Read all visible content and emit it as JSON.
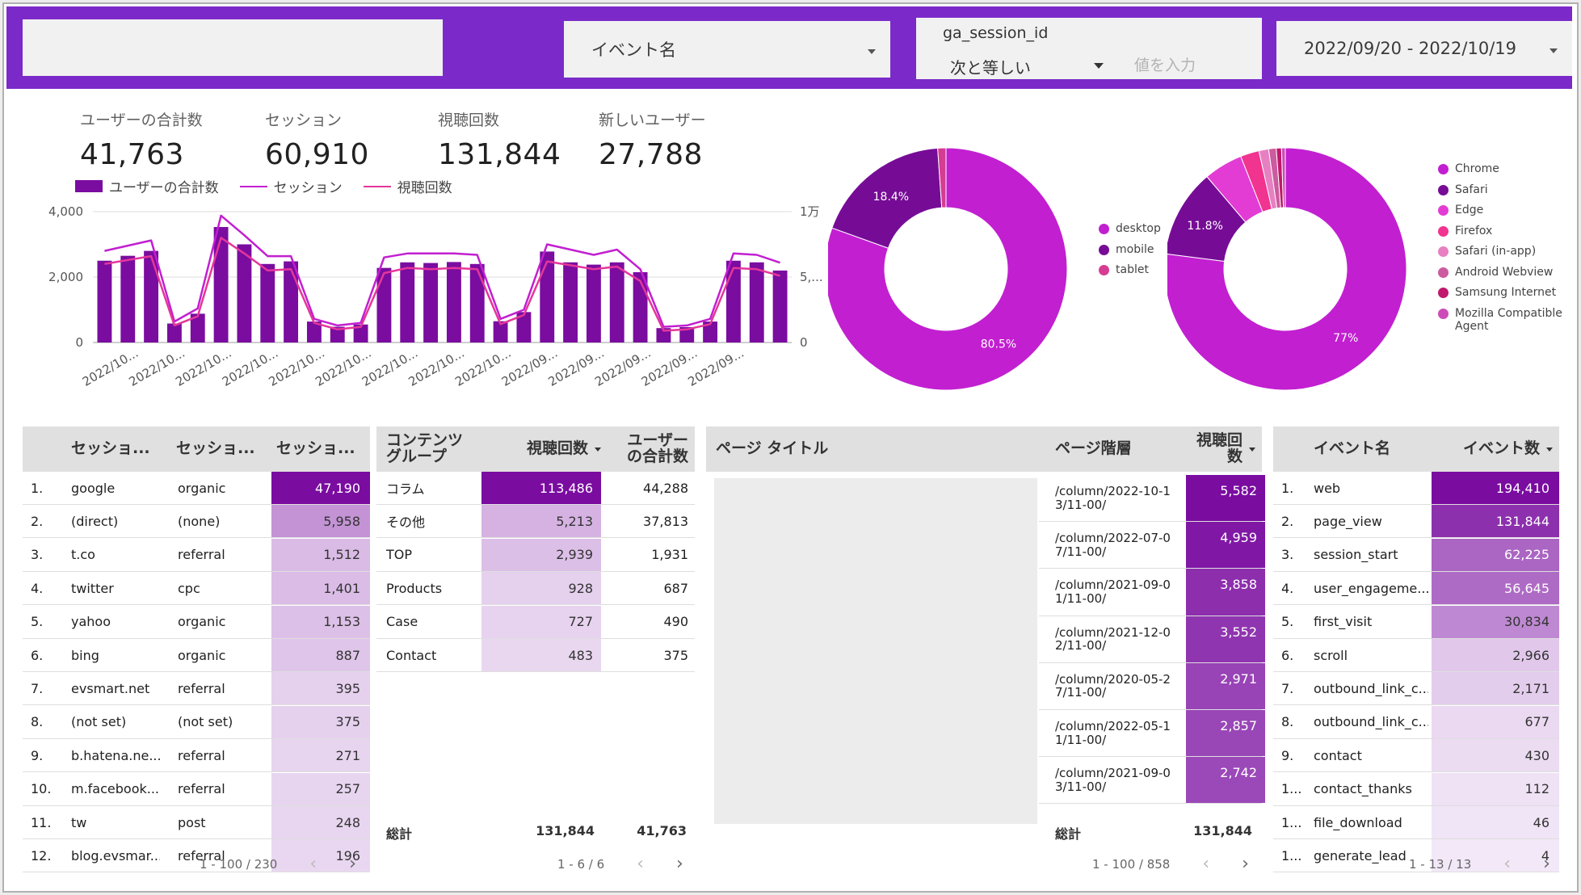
{
  "header": {
    "event_dropdown": "イベント名",
    "filter": {
      "dimension": "ga_session_id",
      "operator": "次と等しい",
      "placeholder": "値を入力"
    },
    "date_range": "2022/09/20 - 2022/10/19"
  },
  "kpis": [
    {
      "label": "ユーザーの合計数",
      "value": "41,763"
    },
    {
      "label": "セッション",
      "value": "60,910"
    },
    {
      "label": "視聴回数",
      "value": "131,844"
    },
    {
      "label": "新しいユーザー",
      "value": "27,788"
    }
  ],
  "combo_legend": [
    "ユーザーの合計数",
    "セッション",
    "視聴回数"
  ],
  "colors": {
    "header": "#7b2ac9",
    "bar": "#7a0ca0",
    "line_session": "#c21fd1",
    "line_views": "#e5369a",
    "heat_strong": "#7a0ca0",
    "heat_light": "#f3eaf8"
  },
  "chart_data": [
    {
      "type": "bar",
      "title": "",
      "x_tick_labels": [
        "2022/10...",
        "2022/10...",
        "2022/10...",
        "2022/10...",
        "2022/10...",
        "2022/10...",
        "2022/10...",
        "2022/10...",
        "2022/10...",
        "2022/09...",
        "2022/09...",
        "2022/09...",
        "2022/09...",
        "2022/09..."
      ],
      "y_left_ticks": [
        "4,000",
        "2,000",
        "0"
      ],
      "y_right_ticks": [
        "1万",
        "5,...",
        "0"
      ],
      "ylim_left": [
        0,
        4000
      ],
      "ylim_right": [
        0,
        10000
      ],
      "series": [
        {
          "name": "ユーザーの合計数",
          "type": "bar",
          "axis": "left",
          "values": [
            2500,
            2650,
            2800,
            580,
            880,
            3530,
            3000,
            2400,
            2480,
            640,
            480,
            550,
            2280,
            2450,
            2430,
            2460,
            2400,
            650,
            930,
            2780,
            2450,
            2380,
            2450,
            2150,
            440,
            470,
            640,
            2500,
            2450,
            2200
          ]
        },
        {
          "name": "セッション",
          "type": "line",
          "axis": "right",
          "values": [
            7000,
            7400,
            7800,
            1600,
            2600,
            9700,
            8200,
            6600,
            6600,
            1800,
            1300,
            1500,
            6500,
            6800,
            6800,
            6800,
            6700,
            1800,
            2500,
            7500,
            7100,
            6700,
            7100,
            5600,
            1200,
            1300,
            1800,
            6800,
            6700,
            6100
          ]
        },
        {
          "name": "視聴回数",
          "type": "line",
          "axis": "right",
          "values": [
            6000,
            6300,
            6600,
            1300,
            2000,
            8000,
            6800,
            5500,
            5600,
            1500,
            1000,
            1200,
            5300,
            5700,
            5600,
            5700,
            5600,
            1400,
            2100,
            6200,
            5900,
            5600,
            5800,
            4700,
            900,
            1000,
            1400,
            5700,
            5600,
            5100
          ]
        }
      ]
    },
    {
      "type": "pie",
      "categories": [
        "desktop",
        "mobile",
        "tablet"
      ],
      "values": [
        80.5,
        18.4,
        1.1
      ],
      "colors": [
        "#c21fd1",
        "#760c96",
        "#d63c91"
      ],
      "labels": [
        "80.5%",
        "18.4%",
        ""
      ]
    },
    {
      "type": "pie",
      "categories": [
        "Chrome",
        "Safari",
        "Edge",
        "Firefox",
        "Safari (in-app)",
        "Android Webview",
        "Samsung Internet",
        "Mozilla Compatible Agent"
      ],
      "values": [
        77,
        11.8,
        5.2,
        2.5,
        1.3,
        1.0,
        0.7,
        0.5
      ],
      "colors": [
        "#c21fd1",
        "#760c96",
        "#e33cd4",
        "#f0348f",
        "#e780c2",
        "#cc5b9f",
        "#c0186d",
        "#cd4bb9"
      ],
      "labels": [
        "77%",
        "11.8%",
        "",
        "",
        "",
        "",
        "",
        ""
      ]
    }
  ],
  "table_sources": {
    "headers": [
      "セッショ...",
      "セッショ...",
      "セッショ..."
    ],
    "rows": [
      [
        "1.",
        "google",
        "organic",
        "47,190"
      ],
      [
        "2.",
        "(direct)",
        "(none)",
        "5,958"
      ],
      [
        "3.",
        "t.co",
        "referral",
        "1,512"
      ],
      [
        "4.",
        "twitter",
        "cpc",
        "1,401"
      ],
      [
        "5.",
        "yahoo",
        "organic",
        "1,153"
      ],
      [
        "6.",
        "bing",
        "organic",
        "887"
      ],
      [
        "7.",
        "evsmart.net",
        "referral",
        "395"
      ],
      [
        "8.",
        "(not set)",
        "(not set)",
        "375"
      ],
      [
        "9.",
        "b.hatena.ne....",
        "referral",
        "271"
      ],
      [
        "10.",
        "m.facebook....",
        "referral",
        "257"
      ],
      [
        "11.",
        "tw",
        "post",
        "248"
      ],
      [
        "12.",
        "blog.evsmar...",
        "referral",
        "196"
      ]
    ],
    "pager": "1 - 100 / 230"
  },
  "table_content": {
    "headers": [
      "コンテンツ グループ",
      "視聴回数",
      "ユーザー の合計数"
    ],
    "rows": [
      [
        "コラム",
        "113,486",
        "44,288"
      ],
      [
        "その他",
        "5,213",
        "37,813"
      ],
      [
        "TOP",
        "2,939",
        "1,931"
      ],
      [
        "Products",
        "928",
        "687"
      ],
      [
        "Case",
        "727",
        "490"
      ],
      [
        "Contact",
        "483",
        "375"
      ]
    ],
    "total_label": "総計",
    "totals": [
      "131,844",
      "41,763"
    ],
    "pager": "1 - 6 / 6"
  },
  "table_pages": {
    "headers": [
      "ページ タイトル",
      "ページ階層",
      "視聴回 数"
    ],
    "rows": [
      [
        "/column/2022-10-13/11-00/",
        "5,582"
      ],
      [
        "/column/2022-07-07/11-00/",
        "4,959"
      ],
      [
        "/column/2021-09-01/11-00/",
        "3,858"
      ],
      [
        "/column/2021-12-02/11-00/",
        "3,552"
      ],
      [
        "/column/2020-05-27/11-00/",
        "2,971"
      ],
      [
        "/column/2022-05-11/11-00/",
        "2,857"
      ],
      [
        "/column/2021-09-03/11-00/",
        "2,742"
      ]
    ],
    "total_label": "総計",
    "total": "131,844",
    "pager": "1 - 100 / 858"
  },
  "table_events": {
    "headers": [
      "イベント名",
      "イベント数"
    ],
    "rows": [
      [
        "1.",
        "web",
        "194,410"
      ],
      [
        "2.",
        "page_view",
        "131,844"
      ],
      [
        "3.",
        "session_start",
        "62,225"
      ],
      [
        "4.",
        "user_engageme...",
        "56,645"
      ],
      [
        "5.",
        "first_visit",
        "30,834"
      ],
      [
        "6.",
        "scroll",
        "2,966"
      ],
      [
        "7.",
        "outbound_link_c...",
        "2,171"
      ],
      [
        "8.",
        "outbound_link_c...",
        "677"
      ],
      [
        "9.",
        "contact",
        "430"
      ],
      [
        "1...",
        "contact_thanks",
        "112"
      ],
      [
        "1...",
        "file_download",
        "46"
      ],
      [
        "1...",
        "generate_lead",
        "4"
      ]
    ],
    "pager": "1 - 13 / 13"
  },
  "pager_icons": {
    "prev": "chevron-left-icon",
    "next": "chevron-right-icon"
  }
}
